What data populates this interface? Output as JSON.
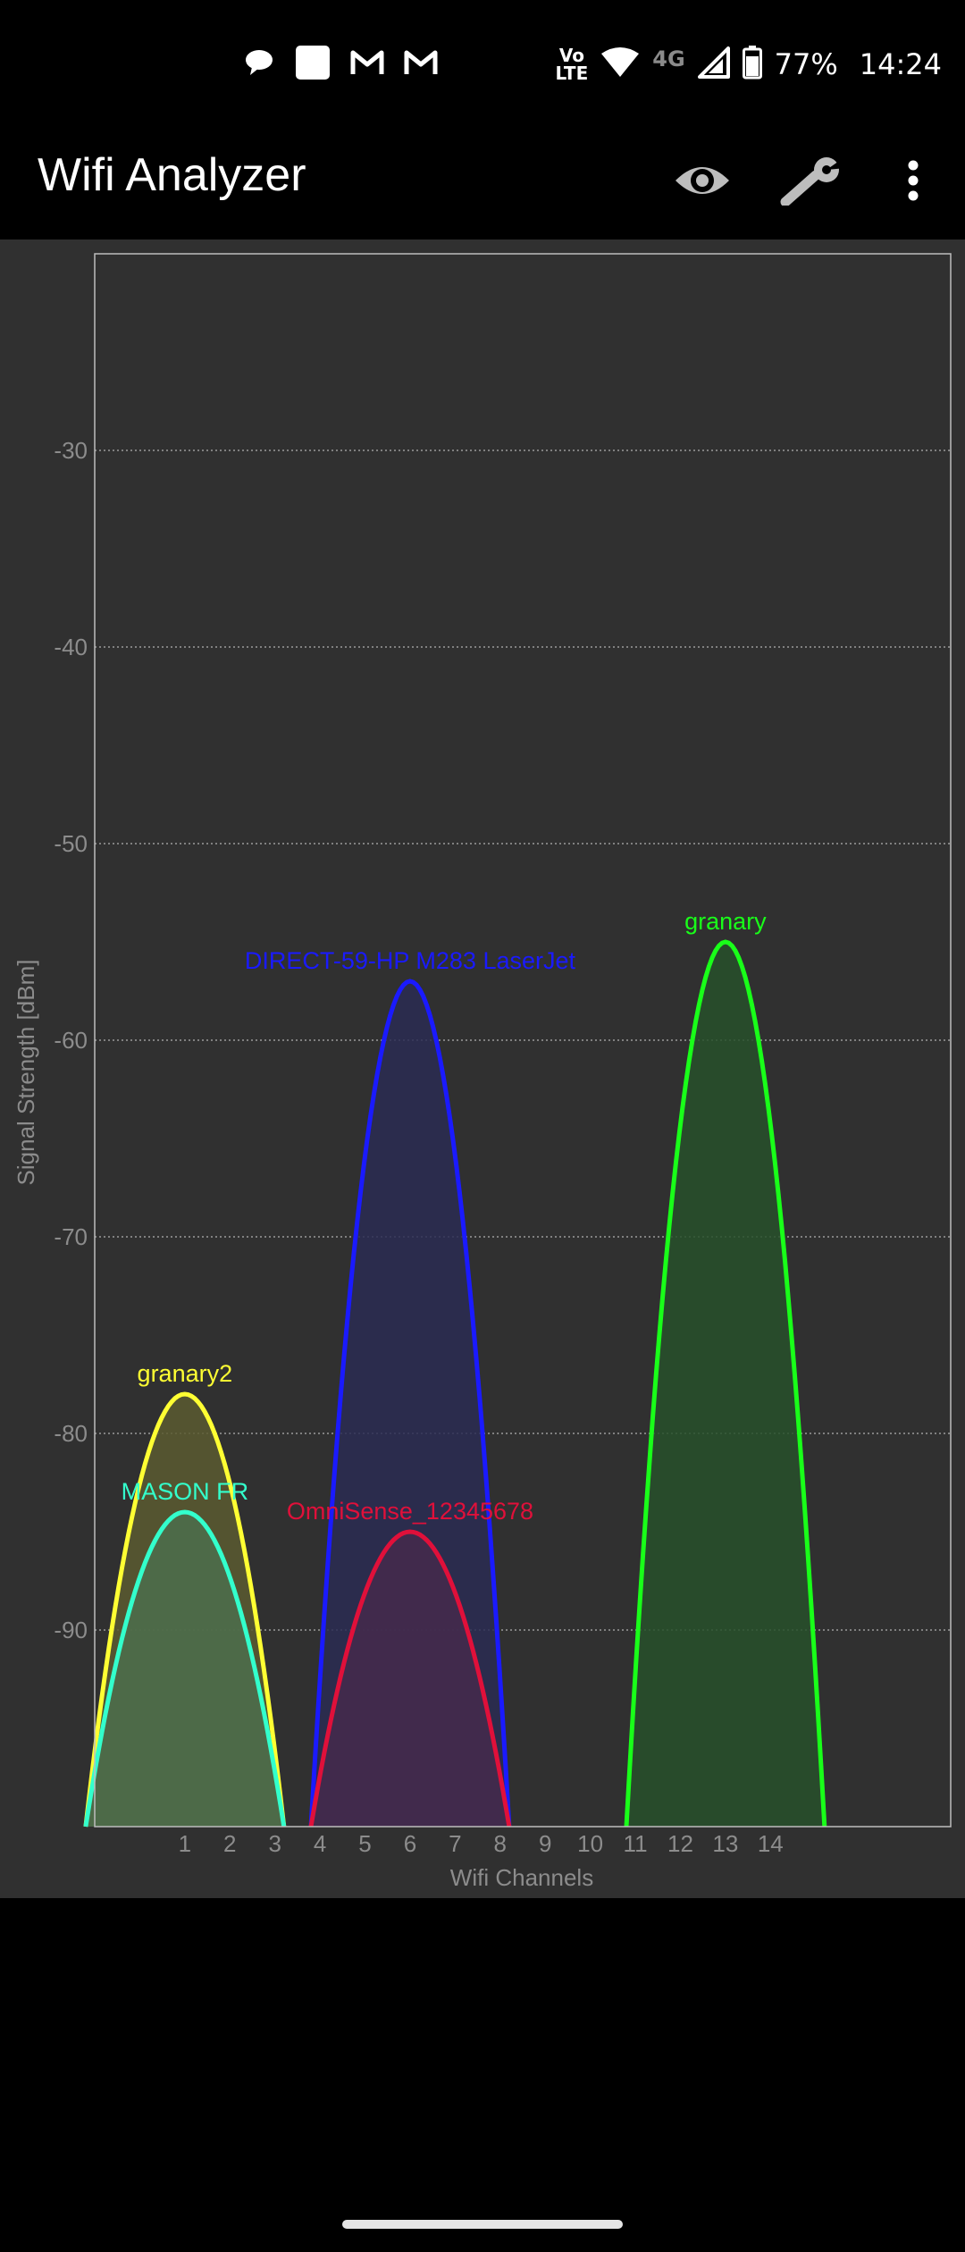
{
  "status_bar": {
    "battery_percent": "77%",
    "time": "14:24",
    "volte_line1": "Vo",
    "volte_line2": "LTE",
    "network_type": "4G",
    "icons": [
      "chat-bubble-icon",
      "white-square-icon",
      "gmail-icon",
      "gmail-icon",
      "volte-icon",
      "wifi-icon",
      "signal-icon",
      "battery-icon"
    ]
  },
  "app_bar": {
    "title": "Wifi Analyzer",
    "actions": [
      "eye-icon",
      "wrench-icon",
      "more-vert-icon"
    ]
  },
  "chart_data": {
    "type": "area",
    "xlabel": "Wifi Channels",
    "ylabel": "Signal Strength [dBm]",
    "xlim": [
      -1,
      18
    ],
    "ylim": [
      -100,
      -20
    ],
    "xticks": [
      1,
      2,
      3,
      4,
      5,
      6,
      7,
      8,
      9,
      10,
      11,
      12,
      13,
      14
    ],
    "yticks": [
      -30,
      -40,
      -50,
      -60,
      -70,
      -80,
      -90
    ],
    "grid": true,
    "series": [
      {
        "name": "granary2",
        "channel": 1,
        "peak_dbm": -78,
        "half_width": 2.2,
        "color": "#ffff33",
        "fill": "#5a5a30"
      },
      {
        "name": "MASON FR",
        "channel": 1,
        "peak_dbm": -84,
        "half_width": 2.2,
        "color": "#33ffcc",
        "fill": "#4c6e4c"
      },
      {
        "name": "DIRECT-59-HP M283 LaserJet",
        "channel": 6,
        "peak_dbm": -57,
        "half_width": 2.2,
        "color": "#1a1aff",
        "fill": "#2a2c52"
      },
      {
        "name": "OmniSense_12345678",
        "channel": 6,
        "peak_dbm": -85,
        "half_width": 2.2,
        "color": "#e0103a",
        "fill": "#452a4c"
      },
      {
        "name": "granary",
        "channel": 13,
        "peak_dbm": -55,
        "half_width": 2.2,
        "color": "#19ff19",
        "fill": "#27502a"
      }
    ]
  }
}
